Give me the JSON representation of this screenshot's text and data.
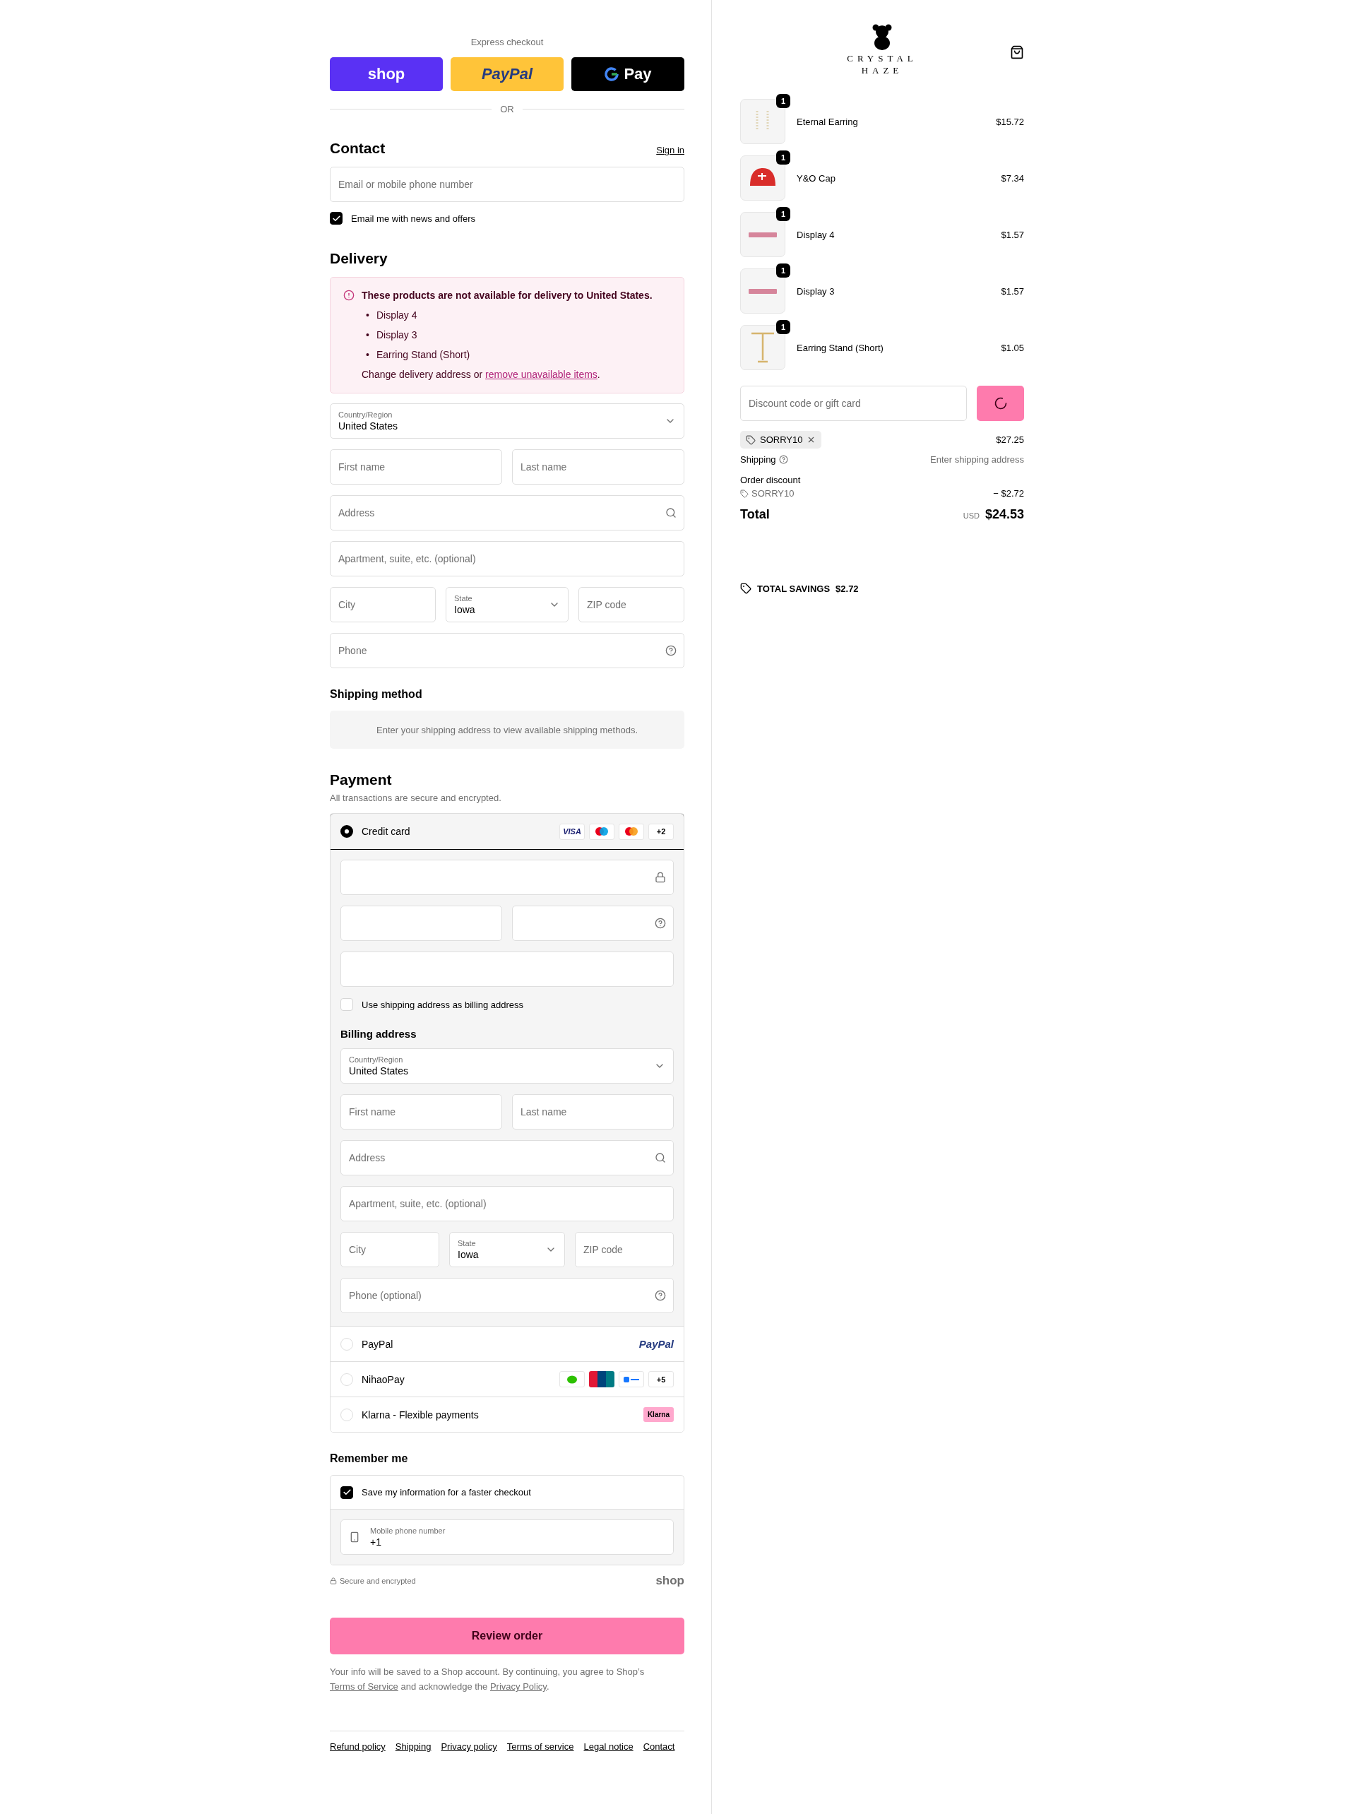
{
  "express": {
    "title": "Express checkout",
    "buttons": [
      {
        "kind": "shop",
        "label": "shop"
      },
      {
        "kind": "paypal",
        "label": "PayPal"
      },
      {
        "kind": "gpay",
        "label": "Pay"
      }
    ],
    "divider": "OR"
  },
  "contact": {
    "title": "Contact",
    "sign_in": "Sign in",
    "email": {
      "placeholder": "Email or mobile phone number"
    },
    "newsletter": {
      "label": "Email me with news and offers",
      "checked": true
    }
  },
  "delivery": {
    "title": "Delivery",
    "warning": {
      "title": "These products are not available for delivery to United States.",
      "marker": "•",
      "items": [
        "Display 4",
        "Display 3",
        "Earring Stand (Short)"
      ],
      "message_before": "Change delivery address or ",
      "link": "remove unavailable items",
      "message_after": "."
    },
    "fields": [
      [
        {
          "kind": "select",
          "label": "Country/Region",
          "value": "United States"
        }
      ],
      [
        {
          "kind": "text",
          "placeholder": "First name"
        },
        {
          "kind": "text",
          "placeholder": "Last name"
        }
      ],
      [
        {
          "kind": "search",
          "placeholder": "Address"
        }
      ],
      [
        {
          "kind": "text",
          "placeholder": "Apartment, suite, etc. (optional)"
        }
      ],
      [
        {
          "kind": "text",
          "placeholder": "City"
        },
        {
          "kind": "select",
          "label": "State",
          "value": "Iowa"
        },
        {
          "kind": "text",
          "placeholder": "ZIP code"
        }
      ],
      [
        {
          "kind": "help",
          "placeholder": "Phone"
        }
      ]
    ]
  },
  "shipping_method": {
    "title": "Shipping method",
    "notice": "Enter your shipping address to view available shipping methods."
  },
  "payment": {
    "title": "Payment",
    "subtitle": "All transactions are secure and encrypted.",
    "methods": [
      {
        "kind": "card",
        "label": "Credit card",
        "selected": true,
        "badges": [
          {
            "kind": "visa",
            "text": "VISA"
          },
          {
            "kind": "maestro"
          },
          {
            "kind": "mastercard"
          }
        ],
        "more": "+2"
      },
      {
        "kind": "paypal",
        "label": "PayPal",
        "selected": false,
        "logo": "PayPal"
      },
      {
        "kind": "badges",
        "label": "NihaoPay",
        "selected": false,
        "badges": [
          {
            "kind": "wechat"
          },
          {
            "kind": "unionpay"
          },
          {
            "kind": "alipay"
          }
        ],
        "more": "+5"
      },
      {
        "kind": "klarna",
        "label": "Klarna - Flexible payments",
        "selected": false,
        "logo": "Klarna"
      }
    ],
    "card_fields": [
      [
        {
          "kind": "lock"
        }
      ],
      [
        {
          "kind": "text"
        },
        {
          "kind": "help"
        }
      ],
      [
        {
          "kind": "text"
        }
      ]
    ],
    "billing_same": {
      "label": "Use shipping address as billing address",
      "checked": false
    },
    "billing": {
      "title": "Billing address",
      "fields": [
        [
          {
            "kind": "select",
            "label": "Country/Region",
            "value": "United States"
          }
        ],
        [
          {
            "kind": "text",
            "placeholder": "First name"
          },
          {
            "kind": "text",
            "placeholder": "Last name"
          }
        ],
        [
          {
            "kind": "search",
            "placeholder": "Address"
          }
        ],
        [
          {
            "kind": "text",
            "placeholder": "Apartment, suite, etc. (optional)"
          }
        ],
        [
          {
            "kind": "text",
            "placeholder": "City"
          },
          {
            "kind": "select",
            "label": "State",
            "value": "Iowa"
          },
          {
            "kind": "text",
            "placeholder": "ZIP code"
          }
        ],
        [
          {
            "kind": "help",
            "placeholder": "Phone (optional)"
          }
        ]
      ]
    }
  },
  "remember": {
    "title": "Remember me",
    "save": {
      "label": "Save my information for a faster checkout",
      "checked": true
    },
    "phone": {
      "label": "Mobile phone number",
      "value": "+1"
    },
    "secure": "Secure and encrypted",
    "shop_logo": "shop"
  },
  "review_button": "Review order",
  "terms": [
    {
      "kind": "text",
      "text": "Your info will be saved to a Shop account. By continuing, you agree to Shop’s "
    },
    {
      "kind": "link",
      "text": "Terms of Service"
    },
    {
      "kind": "text",
      "text": " and acknowledge the "
    },
    {
      "kind": "link",
      "text": "Privacy Policy"
    },
    {
      "kind": "text",
      "text": "."
    }
  ],
  "footer_links": [
    "Refund policy",
    "Shipping",
    "Privacy policy",
    "Terms of service",
    "Legal notice",
    "Contact"
  ],
  "summary": {
    "logo": {
      "line1": "CRYSTAL",
      "line2": "HAZE"
    },
    "items": [
      {
        "kind": "earring",
        "name": "Eternal Earring",
        "price": "$15.72",
        "quantity": "1"
      },
      {
        "kind": "cap",
        "name": "Y&O Cap",
        "price": "$7.34",
        "quantity": "1"
      },
      {
        "kind": "tray",
        "name": "Display 4",
        "price": "$1.57",
        "quantity": "1"
      },
      {
        "kind": "tray",
        "name": "Display 3",
        "price": "$1.57",
        "quantity": "1"
      },
      {
        "kind": "stand",
        "name": "Earring Stand (Short)",
        "price": "$1.05",
        "quantity": "1"
      }
    ],
    "discount": {
      "placeholder": "Discount code or gift card"
    },
    "applied_code": "SORRY10",
    "subtotal": "$27.25",
    "shipping": {
      "label": "Shipping",
      "value": "Enter shipping address"
    },
    "order_discount": {
      "label": "Order discount",
      "code": "SORRY10",
      "amount": "− $2.72"
    },
    "total": {
      "label": "Total",
      "currency": "USD",
      "amount": "$24.53"
    },
    "savings": {
      "label": "TOTAL SAVINGS",
      "amount": "$2.72"
    }
  }
}
